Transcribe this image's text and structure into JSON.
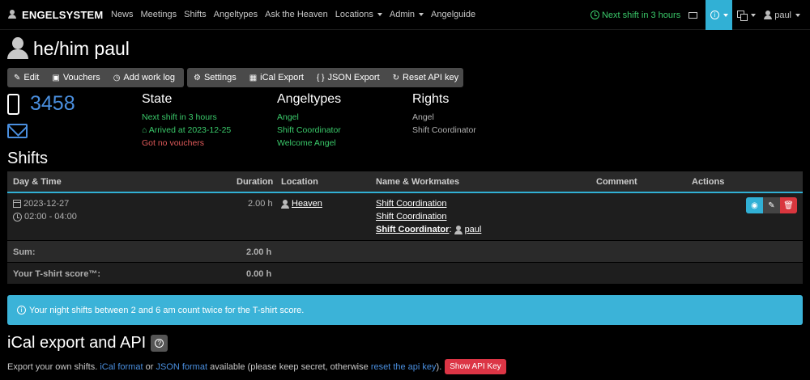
{
  "navbar": {
    "brand": "ENGELSYSTEM",
    "links": [
      "News",
      "Meetings",
      "Shifts",
      "Angeltypes",
      "Ask the Heaven"
    ],
    "dropdowns": [
      "Locations",
      "Admin"
    ],
    "last_link": "Angelguide",
    "next_shift": "Next shift in 3 hours",
    "user": "paul"
  },
  "header": {
    "title": "he/him paul"
  },
  "toolbar": {
    "edit": "Edit",
    "vouchers": "Vouchers",
    "add_work_log": "Add work log",
    "settings": "Settings",
    "ical_export": "iCal Export",
    "json_export": "JSON Export",
    "reset_api_key": "Reset API key",
    "json_icon": "{ }"
  },
  "profile": {
    "phone": "3458"
  },
  "state": {
    "heading": "State",
    "next_shift": "Next shift in 3 hours",
    "arrived": "Arrived at 2023-12-25",
    "vouchers": "Got no vouchers"
  },
  "angeltypes": {
    "heading": "Angeltypes",
    "items": [
      "Angel",
      "Shift Coordinator",
      "Welcome Angel"
    ]
  },
  "rights": {
    "heading": "Rights",
    "items": [
      "Angel",
      "Shift Coordinator"
    ]
  },
  "shifts": {
    "heading": "Shifts",
    "columns": [
      "Day & Time",
      "Duration",
      "Location",
      "Name & Workmates",
      "Comment",
      "Actions"
    ],
    "rows": [
      {
        "date": "2023-12-27",
        "time": "02:00 - 04:00",
        "duration": "2.00 h",
        "location": "Heaven",
        "name1": "Shift Coordination",
        "name2": "Shift Coordination",
        "role": "Shift Coordinator",
        "worker": "paul"
      }
    ],
    "sum_label": "Sum:",
    "sum_value": "2.00 h",
    "score_label": "Your T-shirt score™:",
    "score_value": "0.00 h"
  },
  "alert": {
    "text": "Your night shifts between 2 and 6 am count twice for the T-shirt score."
  },
  "ical": {
    "heading": "iCal export and API",
    "text1": "Export your own shifts.",
    "link1": "iCal format",
    "text2": "or",
    "link2": "JSON format",
    "text3": "available (please keep secret, otherwise",
    "link3": "reset the api key",
    "text4": ").",
    "button": "Show API Key"
  },
  "colors": {
    "accent": "#31b0d5",
    "success": "#3ac96a",
    "danger": "#dc3545",
    "link": "#4a8fdf"
  }
}
